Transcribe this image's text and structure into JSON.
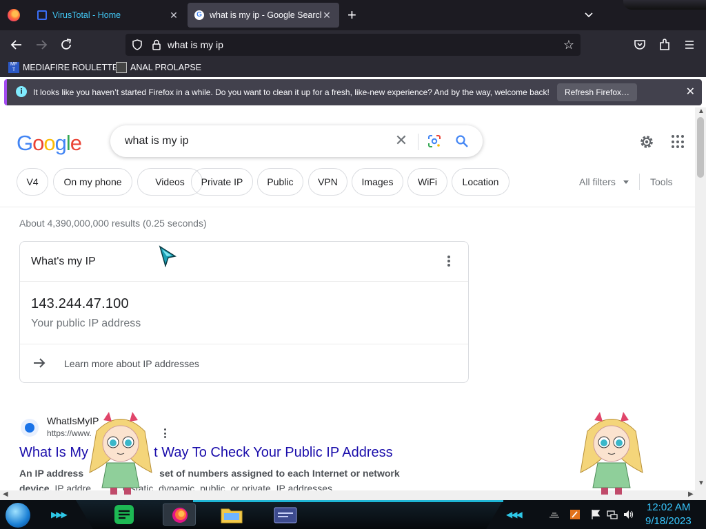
{
  "browser": {
    "tabs": [
      {
        "title": "VirusTotal - Home",
        "close": "✕"
      },
      {
        "title": "what is my ip - Google Search",
        "close": "✕"
      }
    ],
    "new_tab": "+",
    "url": "what is my ip",
    "bookmarks": [
      {
        "label": "MEDIAFIRE ROULETTER",
        "icon_text": "MF T"
      },
      {
        "label": "ANAL PROLAPSE"
      }
    ],
    "notification": {
      "icon": "i",
      "text": "It looks like you haven’t started Firefox in a while. Do you want to clean it up for a fresh, like-new experience? And by the way, welcome back!",
      "button": "Refresh Firefox…",
      "close": "✕"
    }
  },
  "google": {
    "logo": [
      "G",
      "o",
      "o",
      "g",
      "l",
      "e"
    ],
    "logo_colors": [
      "#4285f4",
      "#ea4335",
      "#fbbc05",
      "#4285f4",
      "#34a853",
      "#ea4335"
    ],
    "query": "what is my ip",
    "chips": [
      "V4",
      "On my phone",
      "Videos",
      "Private IP",
      "Public",
      "VPN",
      "Images",
      "WiFi",
      "Location"
    ],
    "all_filters": "All filters",
    "tools": "Tools",
    "result_stats": "About 4,390,000,000 results (0.25 seconds)",
    "ip_card": {
      "heading": "What's my IP",
      "ip": "143.244.47.100",
      "subtitle": "Your public IP address",
      "learn_more": "Learn more about IP addresses"
    },
    "result": {
      "site_name": "WhatIsMyIP",
      "site_url": "https://www.",
      "title_start": "What Is My",
      "title_end": "t Way To Check Your Public IP Address",
      "snippet_line1_a": "An IP address",
      "snippet_line1_b": "set of numbers assigned to each Internet or network",
      "snippet_line2_a": "device.",
      "snippet_line2_b": "IP addre",
      "snippet_line2_c": "e static, dynamic, public, or private. IP addresses"
    }
  },
  "taskbar": {
    "time": "12:02 AM",
    "date": "9/18/2023"
  },
  "colors": {
    "firefox_toolbar": "#2b2a33",
    "firefox_tabstrip": "#1c1b22",
    "google_link": "#1a0dab",
    "clock": "#38c8ff"
  }
}
